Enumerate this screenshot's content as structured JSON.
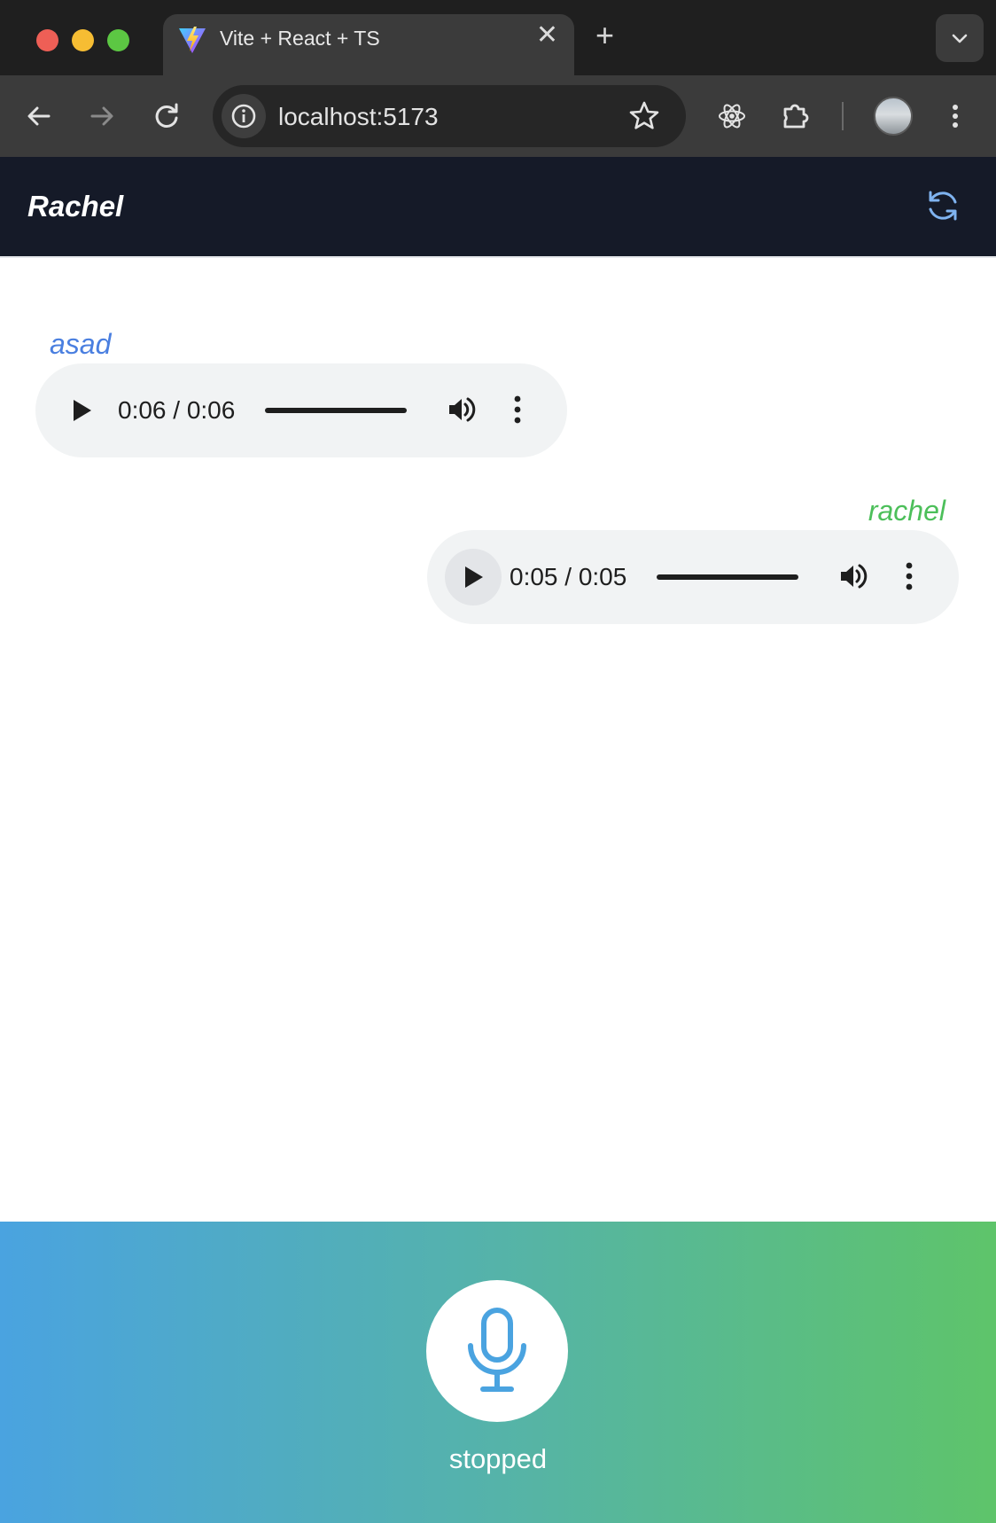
{
  "browser": {
    "tab_title": "Vite + React + TS",
    "url": "localhost:5173",
    "icons": {
      "back": "arrow-left-icon",
      "forward": "arrow-right-icon",
      "reload": "reload-icon",
      "site_info": "info-icon",
      "bookmark": "star-icon",
      "react_devtools": "react-icon",
      "extensions": "puzzle-icon",
      "menu": "kebab-menu-icon"
    }
  },
  "app": {
    "title": "Rachel",
    "refresh_icon": "refresh-icon"
  },
  "messages": [
    {
      "sender": "asad",
      "time": "0:06 / 0:06",
      "color": "#4a7fe0",
      "align": "left"
    },
    {
      "sender": "rachel",
      "time": "0:05 / 0:05",
      "color": "#4cbf5a",
      "align": "right"
    }
  ],
  "recorder": {
    "status": "stopped",
    "icon": "microphone-icon",
    "gradient": [
      "#4aa3e0",
      "#5ec46a"
    ]
  }
}
